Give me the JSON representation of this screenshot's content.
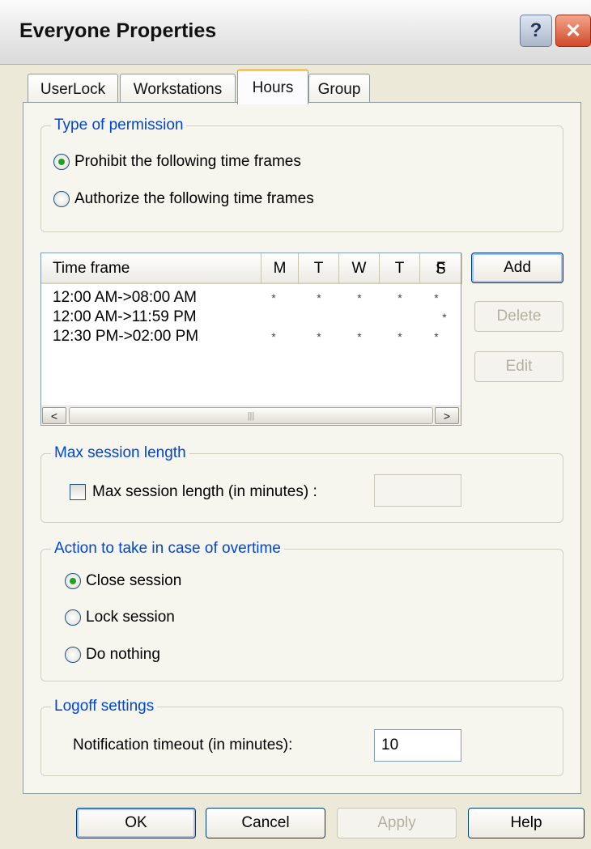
{
  "window": {
    "title": "Everyone Properties"
  },
  "titlebar_buttons": {
    "help": "?",
    "close": "✕"
  },
  "tabs": [
    {
      "label": "UserLock",
      "active": false
    },
    {
      "label": "Workstations",
      "active": false
    },
    {
      "label": "Hours",
      "active": true
    },
    {
      "label": "Group",
      "active": false
    }
  ],
  "permission": {
    "legend": "Type of permission",
    "options": [
      {
        "label": "Prohibit the following time frames",
        "checked": true
      },
      {
        "label": "Authorize the following time frames",
        "checked": false
      }
    ]
  },
  "timeframes": {
    "headers": [
      "Time frame",
      "M",
      "T",
      "W",
      "T",
      "F",
      "S"
    ],
    "rows": [
      {
        "frame": "12:00 AM->08:00 AM",
        "days": [
          "*",
          "*",
          "*",
          "*",
          "*",
          ""
        ]
      },
      {
        "frame": "12:00 AM->11:59 PM",
        "days": [
          "",
          "",
          "",
          "",
          "",
          "*"
        ]
      },
      {
        "frame": "12:30 PM->02:00 PM",
        "days": [
          "*",
          "*",
          "*",
          "*",
          "*",
          ""
        ]
      }
    ],
    "scroll_left": "<",
    "scroll_right": ">",
    "scroll_grip": "|||"
  },
  "list_buttons": {
    "add": "Add",
    "delete": "Delete",
    "edit": "Edit"
  },
  "max_session": {
    "legend": "Max session length",
    "checkbox_label": "Max session length (in minutes) :",
    "checked": false,
    "value": ""
  },
  "overtime": {
    "legend": "Action to take in case of overtime",
    "options": [
      {
        "label": "Close session",
        "checked": true
      },
      {
        "label": "Lock session",
        "checked": false
      },
      {
        "label": "Do nothing",
        "checked": false
      }
    ]
  },
  "logoff": {
    "legend": "Logoff settings",
    "label": "Notification timeout (in minutes):",
    "value": "10"
  },
  "footer": {
    "ok": "OK",
    "cancel": "Cancel",
    "apply": "Apply",
    "help": "Help"
  }
}
